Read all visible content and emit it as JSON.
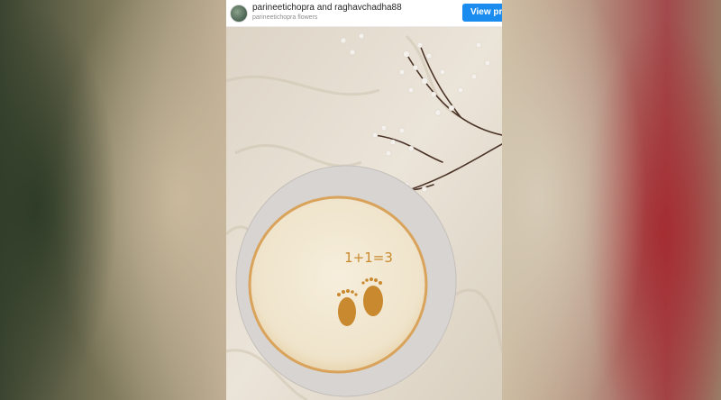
{
  "post": {
    "usernames": "parineetichopra and raghavchadha88",
    "subline": "parineetichopra flowers",
    "view_button": "View profile"
  },
  "cake": {
    "text": "1+1=3"
  },
  "colors": {
    "button": "#1a8cf0",
    "frosting": "#f3ead5",
    "crust": "#d9a35c",
    "footprints": "#c9892e",
    "plate": "#d6d2cf",
    "cloth": "#e7dfd3"
  },
  "icons": [
    "avatar-icon",
    "footprint-icon"
  ]
}
